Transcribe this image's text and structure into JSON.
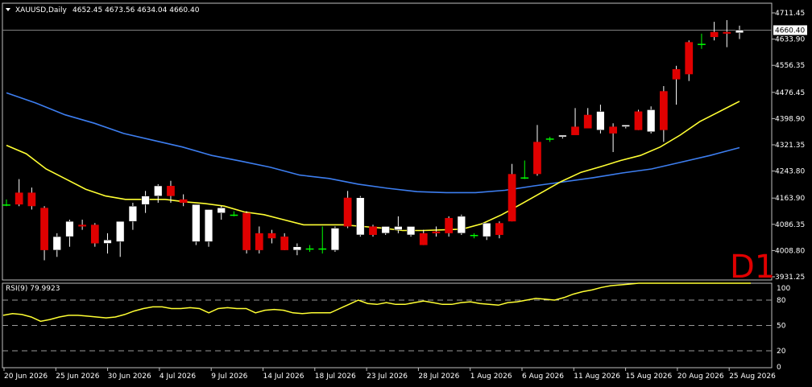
{
  "header": {
    "symbol": "XAUUSD,Daily",
    "ohlc": "4652.45 4673.56 4634.04 4660.40"
  },
  "watermark": "D1",
  "rsi_label": "RSI(9) 79.9923",
  "colors": {
    "background": "#000000",
    "frame": "#c0c0c0",
    "bull_candle": "#ffffff",
    "bear_candle": "#e00000",
    "doji": "#00ff00",
    "ma_fast": "#ffff33",
    "ma_slow": "#3d7ef0",
    "rsi": "#ffff33",
    "price_line": "#808080",
    "watermark": "#e00000"
  },
  "chart_data": [
    {
      "type": "candlestick",
      "price_axis": {
        "range": [
          3931.25,
          4711.45
        ],
        "ticks": [
          4711.45,
          4633.9,
          4556.35,
          4476.45,
          4398.9,
          4321.35,
          4243.8,
          4163.9,
          4086.35,
          4008.8,
          3931.25
        ],
        "current_price": 4660.4
      },
      "date_ticks": [
        "20 Jun 2026",
        "25 Jun 2026",
        "30 Jun 2026",
        "4 Jul 2026",
        "9 Jul 2026",
        "14 Jul 2026",
        "18 Jul 2026",
        "23 Jul 2026",
        "28 Jul 2026",
        "1 Aug 2026",
        "6 Aug 2026",
        "11 Aug 2026",
        "15 Aug 2026",
        "20 Aug 2026",
        "25 Aug 2026"
      ],
      "candles": [
        [
          4145,
          4160,
          4140,
          4145
        ],
        [
          4180,
          4220,
          4140,
          4145
        ],
        [
          4180,
          4195,
          4130,
          4140
        ],
        [
          4135,
          4140,
          3980,
          4010
        ],
        [
          4010,
          4060,
          3990,
          4050
        ],
        [
          4050,
          4100,
          4020,
          4095
        ],
        [
          4085,
          4100,
          4070,
          4080
        ],
        [
          4085,
          4090,
          4020,
          4030
        ],
        [
          4030,
          4060,
          4000,
          4040
        ],
        [
          4035,
          4080,
          3990,
          4095
        ],
        [
          4095,
          4150,
          4070,
          4140
        ],
        [
          4145,
          4185,
          4120,
          4170
        ],
        [
          4170,
          4205,
          4150,
          4200
        ],
        [
          4200,
          4215,
          4150,
          4170
        ],
        [
          4160,
          4175,
          4140,
          4150
        ],
        [
          4035,
          4145,
          4025,
          4145
        ],
        [
          4035,
          4130,
          4020,
          4130
        ],
        [
          4120,
          4140,
          4100,
          4135
        ],
        [
          4115,
          4125,
          4110,
          4115
        ],
        [
          4120,
          4125,
          4000,
          4010
        ],
        [
          4060,
          4080,
          4000,
          4010
        ],
        [
          4060,
          4070,
          4030,
          4045
        ],
        [
          4050,
          4060,
          4010,
          4010
        ],
        [
          4010,
          4030,
          3995,
          4020
        ],
        [
          4015,
          4025,
          4005,
          4015
        ],
        [
          4015,
          4080,
          4000,
          4015
        ],
        [
          4010,
          4080,
          4005,
          4075
        ],
        [
          4165,
          4185,
          4075,
          4080
        ],
        [
          4055,
          4170,
          4050,
          4165
        ],
        [
          4080,
          4085,
          4050,
          4055
        ],
        [
          4060,
          4080,
          4055,
          4080
        ],
        [
          4070,
          4110,
          4060,
          4080
        ],
        [
          4055,
          4080,
          4050,
          4080
        ],
        [
          4060,
          4070,
          4025,
          4025
        ],
        [
          4065,
          4080,
          4050,
          4060
        ],
        [
          4105,
          4110,
          4050,
          4060
        ],
        [
          4060,
          4115,
          4055,
          4110
        ],
        [
          4055,
          4060,
          4045,
          4055
        ],
        [
          4050,
          4090,
          4040,
          4090
        ],
        [
          4090,
          4095,
          4045,
          4055
        ],
        [
          4235,
          4265,
          4095,
          4095
        ],
        [
          4225,
          4275,
          4220,
          4225
        ],
        [
          4330,
          4380,
          4230,
          4235
        ],
        [
          4340,
          4345,
          4330,
          4340
        ],
        [
          4345,
          4350,
          4340,
          4350
        ],
        [
          4375,
          4430,
          4360,
          4350
        ],
        [
          4410,
          4430,
          4380,
          4370
        ],
        [
          4365,
          4440,
          4355,
          4420
        ],
        [
          4375,
          4385,
          4300,
          4355
        ],
        [
          4375,
          4380,
          4370,
          4380
        ],
        [
          4420,
          4425,
          4365,
          4365
        ],
        [
          4360,
          4435,
          4355,
          4425
        ],
        [
          4480,
          4495,
          4330,
          4365
        ],
        [
          4545,
          4555,
          4440,
          4515
        ],
        [
          4625,
          4630,
          4510,
          4530
        ],
        [
          4620,
          4650,
          4605,
          4620
        ],
        [
          4655,
          4685,
          4630,
          4640
        ],
        [
          4655,
          4690,
          4610,
          4650
        ],
        [
          4652.45,
          4673.56,
          4634.04,
          4660.4
        ]
      ],
      "ma_slow": [
        4475,
        4445,
        4410,
        4385,
        4355,
        4335,
        4315,
        4290,
        4273,
        4255,
        4232,
        4222,
        4205,
        4193,
        4183,
        4180,
        4180,
        4187,
        4200,
        4212,
        4224,
        4238,
        4250,
        4270,
        4290,
        4313
      ],
      "ma_fast": [
        4320,
        4295,
        4250,
        4220,
        4190,
        4170,
        4160,
        4160,
        4160,
        4153,
        4148,
        4140,
        4123,
        4115,
        4100,
        4085,
        4085,
        4085,
        4080,
        4075,
        4068,
        4068,
        4070,
        4072,
        4088,
        4115,
        4147,
        4180,
        4213,
        4240,
        4257,
        4275,
        4290,
        4315,
        4350,
        4390,
        4420,
        4450
      ]
    },
    {
      "type": "line",
      "name": "RSI(9)",
      "levels": [
        80,
        50,
        20
      ],
      "ylim": [
        0,
        100
      ],
      "y_ticks": [
        100,
        80,
        50,
        20,
        0
      ],
      "values": [
        62,
        64,
        63,
        60,
        55,
        57,
        60,
        62,
        62,
        61,
        60,
        59,
        60,
        63,
        67,
        70,
        72,
        72,
        70,
        70,
        71,
        70,
        65,
        70,
        71,
        70,
        70,
        65,
        68,
        69,
        68,
        65,
        64,
        65,
        65,
        65,
        70,
        75,
        80,
        76,
        75,
        77,
        75,
        75,
        77,
        79,
        77,
        75,
        75,
        77,
        78,
        76,
        75,
        74,
        77,
        78,
        80,
        82,
        81,
        80,
        83,
        87,
        90,
        92,
        95,
        97,
        98,
        99,
        100,
        101,
        102,
        103,
        105,
        106,
        107,
        108,
        109,
        110,
        110,
        111,
        112
      ]
    }
  ]
}
